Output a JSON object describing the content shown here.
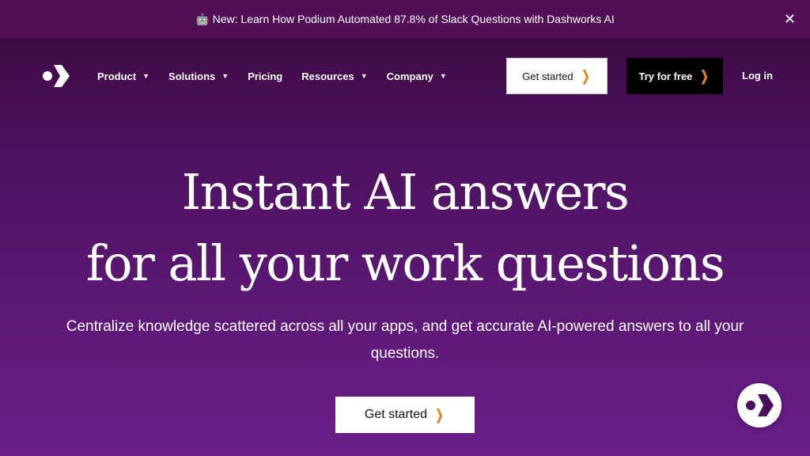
{
  "banner": {
    "emoji": "🤖",
    "text": "New: Learn How Podium Automated 87.8% of Slack Questions with Dashworks AI",
    "close": "✕"
  },
  "nav": {
    "items": [
      {
        "label": "Product",
        "dropdown": true
      },
      {
        "label": "Solutions",
        "dropdown": true
      },
      {
        "label": "Pricing",
        "dropdown": false
      },
      {
        "label": "Resources",
        "dropdown": true
      },
      {
        "label": "Company",
        "dropdown": true
      }
    ],
    "get_started": "Get started",
    "try_free": "Try for free",
    "login": "Log in"
  },
  "hero": {
    "title_line1": "Instant AI answers",
    "title_line2": "for all your work questions",
    "subtitle": "Centralize knowledge scattered across all your apps, and get accurate AI-powered answers to all your questions.",
    "cta": "Get started"
  },
  "colors": {
    "accent": "#d98a22",
    "banner": "#511056",
    "bg_bottom": "#6a1f8a"
  },
  "icons": {
    "logo": "dashworks-logo",
    "chat": "dashworks-chat-launcher",
    "chevron": "chevron-right-icon",
    "caret": "caret-down-icon"
  }
}
